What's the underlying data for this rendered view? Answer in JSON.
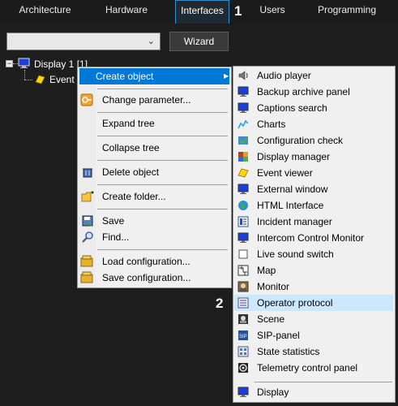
{
  "tabs": [
    {
      "label": "Architecture"
    },
    {
      "label": "Hardware"
    },
    {
      "label": "Interfaces"
    },
    {
      "label": "Users"
    },
    {
      "label": "Programming"
    }
  ],
  "callouts": {
    "one": "1",
    "two": "2"
  },
  "toolbar": {
    "combo_value": "",
    "wizard_label": "Wizard"
  },
  "tree": {
    "root_label": "Display 1 [1]",
    "child_label": "Event v"
  },
  "context_menu": {
    "create_object": "Create object",
    "change_parameter": "Change parameter...",
    "expand_tree": "Expand tree",
    "collapse_tree": "Collapse tree",
    "delete_object": "Delete object",
    "create_folder": "Create folder...",
    "save": "Save",
    "find": "Find...",
    "load_configuration": "Load configuration...",
    "save_configuration": "Save configuration..."
  },
  "submenu": [
    {
      "label": "Audio player",
      "icon": "speaker-icon"
    },
    {
      "label": "Backup archive panel",
      "icon": "monitor-icon"
    },
    {
      "label": "Captions search",
      "icon": "monitor-icon"
    },
    {
      "label": "Charts",
      "icon": "chart-icon"
    },
    {
      "label": "Configuration check",
      "icon": "check-icon"
    },
    {
      "label": "Display manager",
      "icon": "grid-icon"
    },
    {
      "label": "Event viewer",
      "icon": "event-icon"
    },
    {
      "label": "External window",
      "icon": "monitor-icon"
    },
    {
      "label": "HTML Interface",
      "icon": "globe-icon"
    },
    {
      "label": "Incident manager",
      "icon": "list-icon"
    },
    {
      "label": "Intercom Control Monitor",
      "icon": "monitor-icon"
    },
    {
      "label": "Live sound switch",
      "icon": "switch-icon"
    },
    {
      "label": "Map",
      "icon": "map-icon"
    },
    {
      "label": "Monitor",
      "icon": "camera-icon"
    },
    {
      "label": "Operator protocol",
      "icon": "protocol-icon"
    },
    {
      "label": "Scene",
      "icon": "scene-icon"
    },
    {
      "label": "SIP-panel",
      "icon": "sip-icon"
    },
    {
      "label": "State statistics",
      "icon": "stats-icon"
    },
    {
      "label": "Telemetry control panel",
      "icon": "telemetry-icon"
    },
    {
      "label": "Display",
      "icon": "monitor-icon"
    }
  ],
  "colors": {
    "highlight": "#0078d7",
    "submenu_highlight": "#cce8ff",
    "active_tab_border": "#2f8fd0"
  }
}
